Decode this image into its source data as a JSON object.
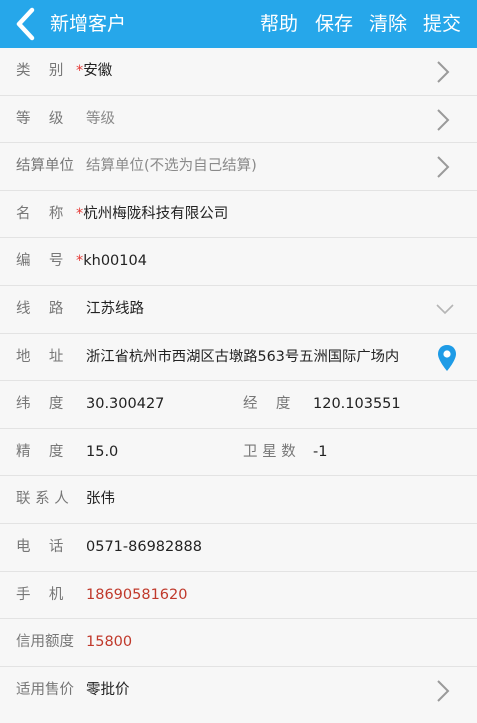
{
  "header": {
    "title": "新增客户",
    "actions": [
      "帮助",
      "保存",
      "清除",
      "提交"
    ]
  },
  "form": {
    "category": {
      "label": "类    别",
      "required": "*",
      "value": "安徽"
    },
    "grade": {
      "label": "等    级",
      "placeholder": "等级"
    },
    "settlement": {
      "label": "结算单位",
      "placeholder": "结算单位(不选为自己结算)"
    },
    "name": {
      "label": "名    称",
      "required": "*",
      "value": "杭州梅陇科技有限公司"
    },
    "code": {
      "label": "编    号",
      "required": "*",
      "value": "kh00104"
    },
    "route": {
      "label": "线    路",
      "value": "江苏线路"
    },
    "address": {
      "label": "地    址",
      "value": "浙江省杭州市西湖区古墩路563号五洲国际广场内"
    },
    "latitude": {
      "label": "纬    度",
      "value": "30.300427"
    },
    "longitude": {
      "label": "经    度",
      "value": "120.103551"
    },
    "precision": {
      "label": "精    度",
      "value": "15.0"
    },
    "satellites": {
      "label": "卫 星 数",
      "value": "-1"
    },
    "contact": {
      "label": "联 系 人",
      "value": "张伟"
    },
    "phone": {
      "label": "电    话",
      "value": "0571-86982888"
    },
    "mobile": {
      "label": "手    机",
      "value": "18690581620"
    },
    "credit": {
      "label": "信用额度",
      "value": "15800"
    },
    "price": {
      "label": "适用售价",
      "value": "零批价"
    }
  },
  "colors": {
    "header_bg": "#26a7ea",
    "required_star": "#e53935",
    "highlight_value": "#c0392b",
    "pin_icon": "#1e9be6"
  }
}
